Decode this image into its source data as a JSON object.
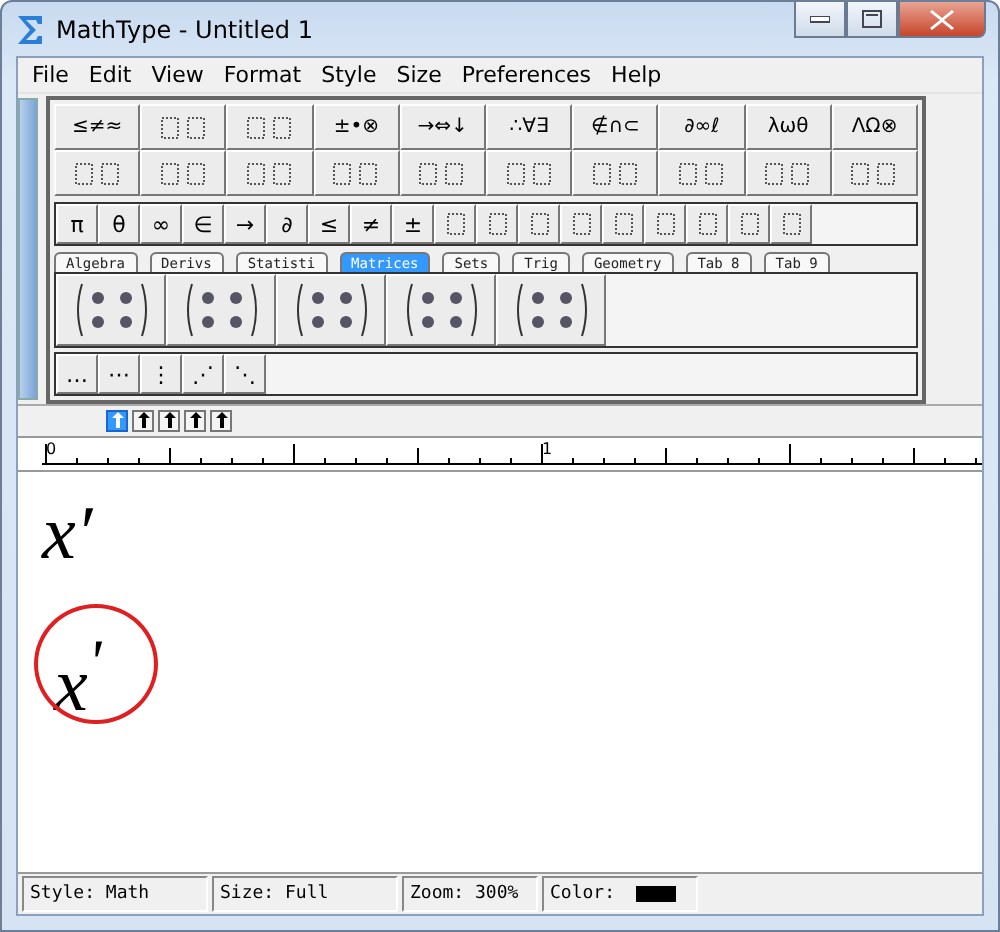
{
  "window": {
    "title": "MathType - Untitled 1"
  },
  "menu": [
    "File",
    "Edit",
    "View",
    "Format",
    "Style",
    "Size",
    "Preferences",
    "Help"
  ],
  "palette_rows": [
    [
      {
        "kind": "text",
        "label": "≤≠≈"
      },
      {
        "kind": "template"
      },
      {
        "kind": "template"
      },
      {
        "kind": "text",
        "label": "±•⊗"
      },
      {
        "kind": "text",
        "label": "→⇔↓"
      },
      {
        "kind": "text",
        "label": "∴∀∃"
      },
      {
        "kind": "text",
        "label": "∉∩⊂"
      },
      {
        "kind": "text",
        "label": "∂∞ℓ"
      },
      {
        "kind": "text",
        "label": "λωθ"
      },
      {
        "kind": "text",
        "label": "ΛΩ⊗"
      }
    ],
    [
      {
        "kind": "template"
      },
      {
        "kind": "template"
      },
      {
        "kind": "template"
      },
      {
        "kind": "template"
      },
      {
        "kind": "template"
      },
      {
        "kind": "template"
      },
      {
        "kind": "template"
      },
      {
        "kind": "template"
      },
      {
        "kind": "template"
      },
      {
        "kind": "template"
      }
    ]
  ],
  "symbol_row": [
    {
      "kind": "text",
      "label": "π"
    },
    {
      "kind": "text",
      "label": "θ"
    },
    {
      "kind": "text",
      "label": "∞"
    },
    {
      "kind": "text",
      "label": "∈"
    },
    {
      "kind": "text",
      "label": "→"
    },
    {
      "kind": "text",
      "label": "∂"
    },
    {
      "kind": "text",
      "label": "≤"
    },
    {
      "kind": "text",
      "label": "≠"
    },
    {
      "kind": "text",
      "label": "±"
    },
    {
      "kind": "template"
    },
    {
      "kind": "template"
    },
    {
      "kind": "template"
    },
    {
      "kind": "template"
    },
    {
      "kind": "template"
    },
    {
      "kind": "template"
    },
    {
      "kind": "template"
    },
    {
      "kind": "template"
    },
    {
      "kind": "template"
    }
  ],
  "tabs": [
    {
      "label": "Algebra",
      "selected": false
    },
    {
      "label": "Derivs",
      "selected": false
    },
    {
      "label": "Statisti",
      "selected": false
    },
    {
      "label": "Matrices",
      "selected": true
    },
    {
      "label": "Sets",
      "selected": false
    },
    {
      "label": "Trig",
      "selected": false
    },
    {
      "label": "Geometry",
      "selected": false
    },
    {
      "label": "Tab 8",
      "selected": false
    },
    {
      "label": "Tab 9",
      "selected": false
    }
  ],
  "templates": [
    {
      "kind": "matrix"
    },
    {
      "kind": "matrix"
    },
    {
      "kind": "matrix"
    },
    {
      "kind": "matrix"
    },
    {
      "kind": "matrix"
    }
  ],
  "dots_row": [
    "…",
    "⋯",
    "⋮",
    "⋰",
    "⋱"
  ],
  "format_buttons": [
    {
      "selected": true
    },
    {
      "selected": false
    },
    {
      "selected": false
    },
    {
      "selected": false
    },
    {
      "selected": false
    }
  ],
  "ruler": {
    "marks": [
      "0",
      "1"
    ]
  },
  "equations": [
    {
      "text": "x′",
      "circled": false
    },
    {
      "text": "x$^{'}$",
      "circled": true
    }
  ],
  "status_bar": {
    "style": "Style: Math",
    "size": "Size: Full",
    "zoom": "Zoom: 300%",
    "color_label": "Color:",
    "color": "#000000"
  }
}
